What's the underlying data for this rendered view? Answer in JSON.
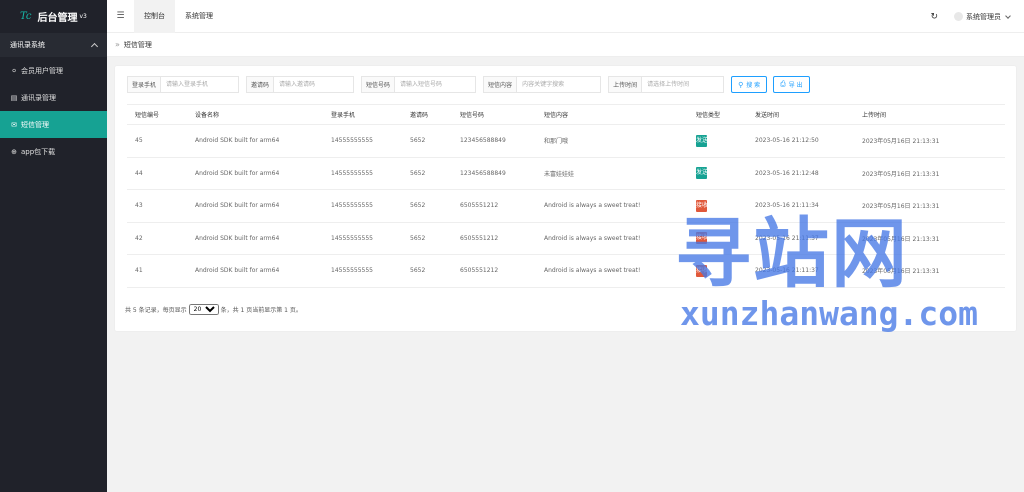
{
  "app": {
    "logo_mark": "Tc",
    "title": "后台管理",
    "version": "v3"
  },
  "sidebar": {
    "group": "通讯录系统",
    "items": [
      {
        "label": "会员用户管理",
        "icon": "user-icon"
      },
      {
        "label": "通讯录管理",
        "icon": "contact-book-icon"
      },
      {
        "label": "短信管理",
        "icon": "message-icon",
        "active": true
      },
      {
        "label": "app包下载",
        "icon": "download-icon"
      }
    ]
  },
  "topbar": {
    "tabs": [
      {
        "label": "控制台",
        "active": true
      },
      {
        "label": "系统管理"
      }
    ],
    "admin": "系统管理员"
  },
  "breadcrumb": {
    "current": "短信管理"
  },
  "filters": {
    "phone": {
      "label": "登录手机",
      "placeholder": "请输入登录手机"
    },
    "invite": {
      "label": "邀请码",
      "placeholder": "请输入邀请码"
    },
    "sms_number": {
      "label": "短信号码",
      "placeholder": "请输入短信号码"
    },
    "content": {
      "label": "短信内容",
      "placeholder": "内容关键字搜索"
    },
    "upload_time": {
      "label": "上传时间",
      "placeholder": "请选择上传时间"
    },
    "search_button": "搜 索",
    "export_button": "导 出"
  },
  "table": {
    "columns": [
      "短信编号",
      "设备名称",
      "登录手机",
      "邀请码",
      "短信号码",
      "短信内容",
      "短信类型",
      "发送时间",
      "上传时间"
    ],
    "rows": [
      {
        "id": "45",
        "device": "Android SDK built for arm64",
        "phone": "14555555555",
        "invite": "5652",
        "number": "123456588849",
        "content": "和那门哦",
        "type": "发送",
        "type_color": "#16a293",
        "sent": "2023-05-16 21:12:50",
        "uploaded": "2023年05月16日 21:13:31"
      },
      {
        "id": "44",
        "device": "Android SDK built for arm64",
        "phone": "14555555555",
        "invite": "5652",
        "number": "123456588849",
        "content": "未富娃娃娃",
        "type": "发送",
        "type_color": "#16a293",
        "sent": "2023-05-16 21:12:48",
        "uploaded": "2023年05月16日 21:13:31"
      },
      {
        "id": "43",
        "device": "Android SDK built for arm64",
        "phone": "14555555555",
        "invite": "5652",
        "number": "6505551212",
        "content": "Android is always a sweet treat!",
        "type": "接收",
        "type_color": "#e0583a",
        "sent": "2023-05-16 21:11:34",
        "uploaded": "2023年05月16日 21:13:31"
      },
      {
        "id": "42",
        "device": "Android SDK built for arm64",
        "phone": "14555555555",
        "invite": "5652",
        "number": "6505551212",
        "content": "Android is always a sweet treat!",
        "type": "接收",
        "type_color": "#e0583a",
        "sent": "2023-05-16 21:11:37",
        "uploaded": "2023年05月16日 21:13:31"
      },
      {
        "id": "41",
        "device": "Android SDK built for arm64",
        "phone": "14555555555",
        "invite": "5652",
        "number": "6505551212",
        "content": "Android is always a sweet treat!",
        "type": "接收",
        "type_color": "#e0583a",
        "sent": "2023-05-16 21:11:37",
        "uploaded": "2023年05月16日 21:13:31"
      }
    ]
  },
  "pager": {
    "prefix": "共 5 条记录，每页显示",
    "page_size": "20",
    "suffix": "条，共 1 页当前显示第 1 页。"
  },
  "watermark": {
    "cn": "寻站网",
    "en": "xunzhanwang.com"
  }
}
